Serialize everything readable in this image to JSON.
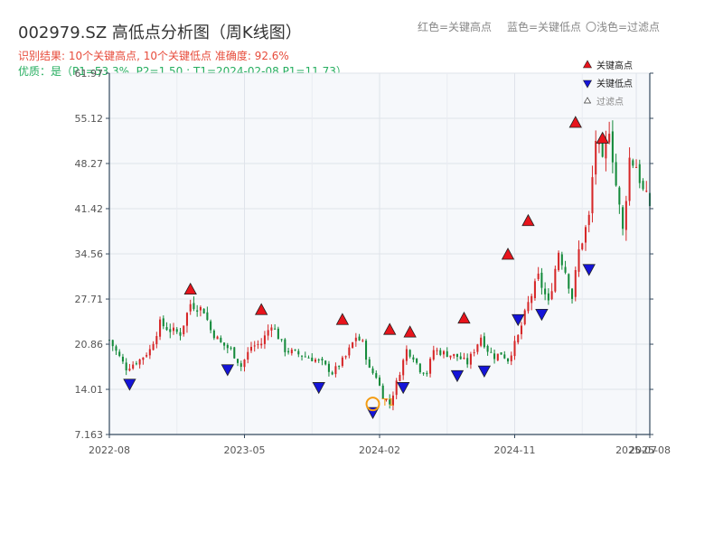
{
  "header": {
    "title": "002979.SZ 高低点分析图（周K线图）",
    "result": "识别结果: 10个关键高点, 10个关键低点  准确度: 92.6%",
    "quality": "优质：是（P1=53.3%, P2=1.50 ; T1=2024-02-08 P1=11.73）",
    "legend_red": "红色=关键高点",
    "legend_blue": "蓝色=关键低点",
    "legend_hollow": "〇浅色=过滤点"
  },
  "colors": {
    "up": "#d62728",
    "down": "#138a3a",
    "high_marker": "#e8141c",
    "low_marker": "#1414d8",
    "t1_ring": "#f39c12",
    "plot_bg": "#f6f8fb",
    "grid": "#dfe3ea",
    "axis": "#34495e"
  },
  "chart_data": {
    "type": "candlestick",
    "yticks": [
      "61.97",
      "55.12",
      "48.27",
      "41.42",
      "34.56",
      "27.71",
      "20.86",
      "14.01",
      "7.163"
    ],
    "ylim": [
      7.163,
      61.97
    ],
    "xticks": [
      {
        "label": "2022-08",
        "w": 0
      },
      {
        "label": "2023-05",
        "w": 40
      },
      {
        "label": "2024-02",
        "w": 80
      },
      {
        "label": "2024-11",
        "w": 120
      },
      {
        "label": "2025-07",
        "w": 156
      },
      {
        "label": "2025-08",
        "w": 160
      }
    ],
    "weeks": 160,
    "anchors": [
      [
        0,
        21.5
      ],
      [
        5,
        17.2
      ],
      [
        9,
        18.5
      ],
      [
        12,
        20
      ],
      [
        15,
        24
      ],
      [
        18,
        23
      ],
      [
        21,
        22.5
      ],
      [
        24,
        27
      ],
      [
        28,
        26
      ],
      [
        30,
        23
      ],
      [
        33,
        21
      ],
      [
        36,
        20
      ],
      [
        39,
        17.5
      ],
      [
        42,
        20.5
      ],
      [
        45,
        21
      ],
      [
        48,
        24
      ],
      [
        50,
        22
      ],
      [
        52,
        20
      ],
      [
        55,
        19.5
      ],
      [
        58,
        19
      ],
      [
        61,
        18.5
      ],
      [
        63,
        18
      ],
      [
        66,
        16.5
      ],
      [
        70,
        19
      ],
      [
        73,
        22
      ],
      [
        75,
        21
      ],
      [
        77,
        17
      ],
      [
        79,
        16
      ],
      [
        81,
        13
      ],
      [
        83,
        11.8
      ],
      [
        85,
        15
      ],
      [
        88,
        20
      ],
      [
        90,
        19
      ],
      [
        92,
        17
      ],
      [
        94,
        16.5
      ],
      [
        96,
        20
      ],
      [
        99,
        19.5
      ],
      [
        103,
        19
      ],
      [
        106,
        18
      ],
      [
        108,
        20
      ],
      [
        110,
        22
      ],
      [
        112,
        20
      ],
      [
        114,
        19
      ],
      [
        116,
        19.5
      ],
      [
        118,
        18.5
      ],
      [
        121,
        22
      ],
      [
        124,
        27
      ],
      [
        127,
        31
      ],
      [
        130,
        27
      ],
      [
        133,
        35
      ],
      [
        135,
        32
      ],
      [
        137,
        28
      ],
      [
        139,
        35
      ],
      [
        142,
        40
      ],
      [
        144,
        52
      ],
      [
        146,
        48
      ],
      [
        148,
        54
      ],
      [
        150,
        45
      ],
      [
        152,
        38
      ],
      [
        154,
        49
      ],
      [
        156,
        48
      ],
      [
        158,
        44
      ],
      [
        160,
        42
      ]
    ],
    "key_highs": [
      {
        "w": 24,
        "v": 27.9
      },
      {
        "w": 45,
        "v": 24.8
      },
      {
        "w": 69,
        "v": 23.3
      },
      {
        "w": 83,
        "v": 21.8
      },
      {
        "w": 89,
        "v": 21.4
      },
      {
        "w": 105,
        "v": 23.5
      },
      {
        "w": 118,
        "v": 33.2
      },
      {
        "w": 124,
        "v": 38.3
      },
      {
        "w": 138,
        "v": 53.2
      },
      {
        "w": 146,
        "v": 50.8
      }
    ],
    "key_lows": [
      {
        "w": 6,
        "v": 16.1
      },
      {
        "w": 35,
        "v": 18.3
      },
      {
        "w": 62,
        "v": 15.6
      },
      {
        "w": 78,
        "v": 11.8
      },
      {
        "w": 87,
        "v": 15.6
      },
      {
        "w": 103,
        "v": 17.4
      },
      {
        "w": 111,
        "v": 18.1
      },
      {
        "w": 121,
        "v": 25.9
      },
      {
        "w": 128,
        "v": 26.7
      },
      {
        "w": 142,
        "v": 33.5
      }
    ],
    "t1": {
      "w": 78,
      "v": 11.8,
      "label": "T1"
    },
    "legend": [
      {
        "kind": "high",
        "label": "关键高点"
      },
      {
        "kind": "low",
        "label": "关键低点"
      },
      {
        "kind": "filtered",
        "label": "过滤点"
      }
    ]
  }
}
